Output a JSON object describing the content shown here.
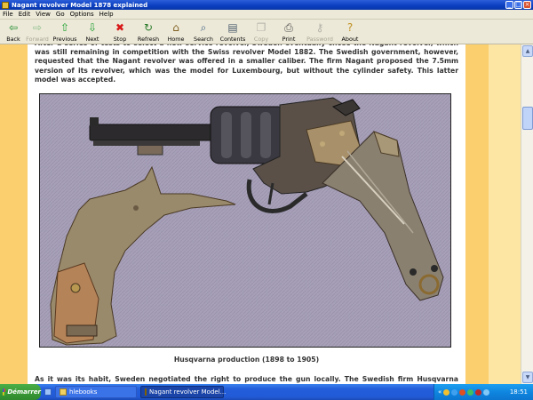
{
  "window": {
    "title": "Nagant revolver Model 1878 explained",
    "controls": [
      "_",
      "□",
      "×"
    ]
  },
  "menubar": [
    "File",
    "Edit",
    "View",
    "Go",
    "Options",
    "Help"
  ],
  "toolbar": [
    {
      "label": "Back",
      "icon": "back-arrow-icon",
      "glyph": "⇦",
      "color": "#1a8a2a",
      "enabled": true
    },
    {
      "label": "Forward",
      "icon": "forward-arrow-icon",
      "glyph": "⇨",
      "color": "#1a8a2a",
      "enabled": false
    },
    {
      "label": "Previous",
      "icon": "previous-arrow-icon",
      "glyph": "⇧",
      "color": "#20a030",
      "enabled": true
    },
    {
      "label": "Next",
      "icon": "next-arrow-icon",
      "glyph": "⇩",
      "color": "#20a030",
      "enabled": true
    },
    {
      "label": "Stop",
      "icon": "stop-icon",
      "glyph": "✖",
      "color": "#d81818",
      "enabled": true
    },
    {
      "label": "Refresh",
      "icon": "refresh-icon",
      "glyph": "↻",
      "color": "#2a7a2a",
      "enabled": true
    },
    {
      "label": "Home",
      "icon": "home-icon",
      "glyph": "⌂",
      "color": "#806020",
      "enabled": true
    },
    {
      "label": "Search",
      "icon": "search-icon",
      "glyph": "⌕",
      "color": "#406080",
      "enabled": true
    },
    {
      "label": "Contents",
      "icon": "contents-icon",
      "glyph": "▤",
      "color": "#506070",
      "enabled": true
    },
    {
      "label": "Copy",
      "icon": "copy-icon",
      "glyph": "❐",
      "color": "#707070",
      "enabled": false
    },
    {
      "label": "Print",
      "icon": "print-icon",
      "glyph": "⎙",
      "color": "#505050",
      "enabled": true
    },
    {
      "label": "Password",
      "icon": "password-icon",
      "glyph": "⚷",
      "color": "#707070",
      "enabled": false
    },
    {
      "label": "About",
      "icon": "about-icon",
      "glyph": "?",
      "color": "#c09020",
      "enabled": true
    }
  ],
  "article": {
    "paragraph_top": "After a series of tests to select a new service revolver, Sweden eventually chose the Nagant revolver, which was still remaining in competition with the Swiss revolver Model 1882. The Swedish government, however, requested that the Nagant revolver was offered in a smaller caliber. The firm Nagant proposed the 7.5mm version of its revolver, which was the model for Luxembourg, but without the cylinder safety. This latter model was accepted.",
    "caption": "Husqvarna production (1898 to 1905)",
    "paragraph_bottom": "As it was its habit, Sweden negotiated the right to produce the gun locally. The Swedish firm Husqvarna began the production"
  },
  "colors": {
    "page_band": "#fbcf6e",
    "page_margin": "#fde5a4",
    "text": "#333333",
    "photo_background": "#a7a0b8"
  },
  "taskbar": {
    "start_label": "Démarrer",
    "tasks": [
      {
        "label": "hlebooks",
        "icon": "folder-icon",
        "active": false
      },
      {
        "label": "Nagant revolver Model...",
        "icon": "ebook-icon",
        "active": true
      }
    ],
    "tray_label": "«",
    "clock": "18:51"
  }
}
